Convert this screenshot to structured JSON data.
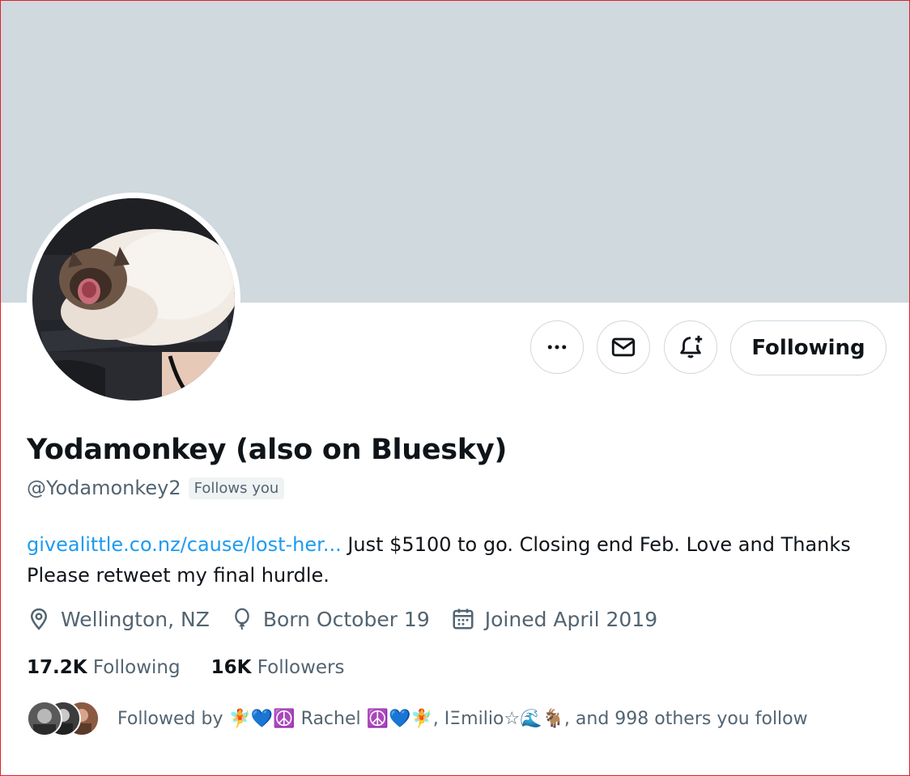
{
  "profile": {
    "display_name": "Yodamonkey (also on Bluesky)",
    "handle": "@Yodamonkey2",
    "follows_you_badge": "Follows you",
    "bio_link": "givealittle.co.nz/cause/lost-her...",
    "bio_text": " Just $5100 to go. Closing end Feb. Love and Thanks Please retweet my final hurdle.",
    "location": "Wellington, NZ",
    "birthday": "Born October 19",
    "joined": "Joined April 2019"
  },
  "actions": {
    "more_icon": "more-dots-icon",
    "message_icon": "envelope-icon",
    "notify_icon": "bell-plus-icon",
    "follow_label": "Following"
  },
  "stats": {
    "following_count": "17.2K",
    "following_label": "Following",
    "followers_count": "16K",
    "followers_label": "Followers"
  },
  "followed_by": {
    "text": "Followed by 🧚💙☮️ Rachel ☮️💙🧚, IΞmilio☆🌊🐐, and 998 others you follow"
  },
  "colors": {
    "banner": "#cfd9de",
    "link": "#1d9bf0",
    "secondary_text": "#536471",
    "primary_text": "#0f1419"
  }
}
